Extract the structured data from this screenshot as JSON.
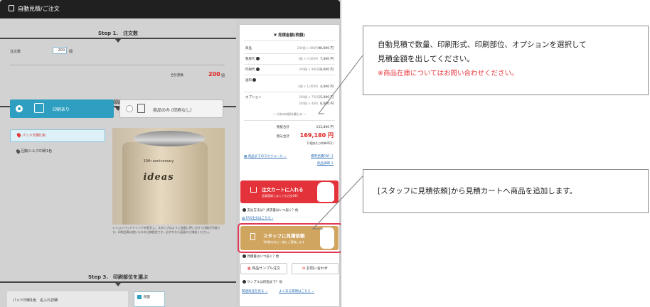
{
  "window": {
    "title": "自動見積/ご注文"
  },
  "step1": {
    "title": "Step 1.　注文数",
    "qty_label": "注文数",
    "qty_value": "200",
    "qty_unit": "個",
    "total_label": "合計部数",
    "total_value": "200",
    "total_unit": "個"
  },
  "step2": {
    "title": "Step 2.　印刷方法を選ぶ",
    "print_label": "印刷あり",
    "noprint_label": "商品のみ (印刷なし)",
    "opt1": "パッド印刷1色",
    "opt2": "回転シルク印刷1色",
    "photo_logo_top": "10th anniversary",
    "photo_logo": "ideas",
    "photo_caption": "シリコンパッドでインクを転写し、スタンプのように曲面に押し付けて印刷が可能です。印刷品質は使いものの仕様設定です。必ずかなも画面のご確認ください。"
  },
  "step3": {
    "title": "Step 3.　印刷部位を選ぶ",
    "row_label": "パッド印刷1色　名入れ詳細",
    "side_label": "側面"
  },
  "estimate": {
    "title": "見積金額(税額)",
    "rows": [
      {
        "label": "商品",
        "sub": "200個 × 490円",
        "value": "98,000 円"
      },
      {
        "label": "製版代",
        "sub": "1版 × 7,000円",
        "value": "7,000 円"
      },
      {
        "label": "印刷代",
        "sub": "200個 × 90円",
        "value": "18,000 円"
      },
      {
        "label": "送料",
        "sub": "4個 × 1,000円",
        "value": "4,000 円"
      },
      {
        "label": "オプション",
        "sub": "200個 × 75円",
        "value": "15,000 円"
      },
      {
        "label": "",
        "sub": "200個 × 40円",
        "value": "8,000 円"
      }
    ],
    "toggle": "小計の内訳を開じる",
    "subtotal_label": "税抜合計",
    "subtotal_value": "153,800 円",
    "total_label": "税込合計",
    "total_value": "169,180 円",
    "per_unit": "(1個あたり約845円)",
    "schedule_link": "商品までのスケジュール",
    "pdf_link": "標準見積PDF",
    "detail_link": "商品詳細"
  },
  "cart": {
    "label": "注文カートに入れる",
    "sub": "会員登録しなくても注文OK!"
  },
  "cart_note": "支払方法は？請求書はいつ届く？他",
  "fax_link": "FAX注文はこちら",
  "staff": {
    "label": "スタッフに見積依頼",
    "sub": "1時間以内に一度にご連絡します"
  },
  "staff_note": "見積書はいつ届く？他",
  "sample_btn": "商品サンプル注文",
  "contact_btn": "お問い合わせ",
  "sample_note": "サンプルは何個まで？他",
  "links": {
    "left": "関連商品を見る",
    "right": "よくある質問はこちら"
  },
  "callout1": {
    "line1": "自動見積で数量、印刷形式、印刷部位、オプションを選択して",
    "line2": "見積金額を出してください。",
    "note": "※商品在庫についてはお問い合わせください。",
    "note_color": "#e8343a"
  },
  "callout2": {
    "line1": "[スタッフに見積依頼]から見積カートへ商品を追加します。"
  }
}
